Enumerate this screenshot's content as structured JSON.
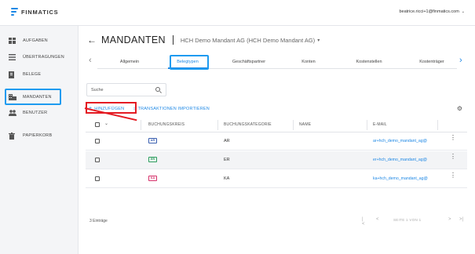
{
  "app": {
    "brand": "FINMATICS",
    "user": "beatrice.ricci+1@finmatics.com",
    "brand_color": "#1e88e5"
  },
  "sidebar": {
    "items": [
      {
        "label": "AUFGABEN",
        "icon": "dashboard-icon"
      },
      {
        "label": "ÜBERTRAGUNGEN",
        "icon": "list-icon"
      },
      {
        "label": "BELEGE",
        "icon": "document-icon"
      },
      {
        "label": "MANDANTEN",
        "icon": "building-icon"
      },
      {
        "label": "BENUTZER",
        "icon": "users-icon"
      },
      {
        "label": "PAPIERKORB",
        "icon": "trash-icon"
      }
    ],
    "active": "MANDANTEN"
  },
  "header": {
    "title": "MANDANTEN",
    "mandant": "HCH Demo Mandant AG (HCH Demo Mandant AG)"
  },
  "tabs": [
    "Allgemein",
    "Belegtypen",
    "Geschäftspartner",
    "Konten",
    "Kostenstellen",
    "Kostenträger"
  ],
  "active_tab": "Belegtypen",
  "search": {
    "placeholder": "Suche"
  },
  "actions": {
    "add": "HINZUFÜGEN",
    "import": "TRANSAKTIONEN IMPORTIEREN"
  },
  "table": {
    "columns": [
      "BUCHUNGSKREIS",
      "BUCHUNGSKATEGORIE",
      "NAME",
      "E-MAIL"
    ],
    "rows": [
      {
        "kreis": "AR",
        "kategorie": "AR",
        "name": "",
        "email": "ar+hch_demo_mandant_ag@",
        "badge_color": "#3a5fb0"
      },
      {
        "kreis": "ER",
        "kategorie": "ER",
        "name": "",
        "email": "er+hch_demo_mandant_ag@",
        "badge_color": "#2a9d5c"
      },
      {
        "kreis": "KA",
        "kategorie": "KA",
        "name": "",
        "email": "ka+hch_demo_mandant_ag@",
        "badge_color": "#d6336c"
      }
    ]
  },
  "footer": {
    "entries": "3 Einträge",
    "page_info": "SEITE 1 VON 1"
  }
}
